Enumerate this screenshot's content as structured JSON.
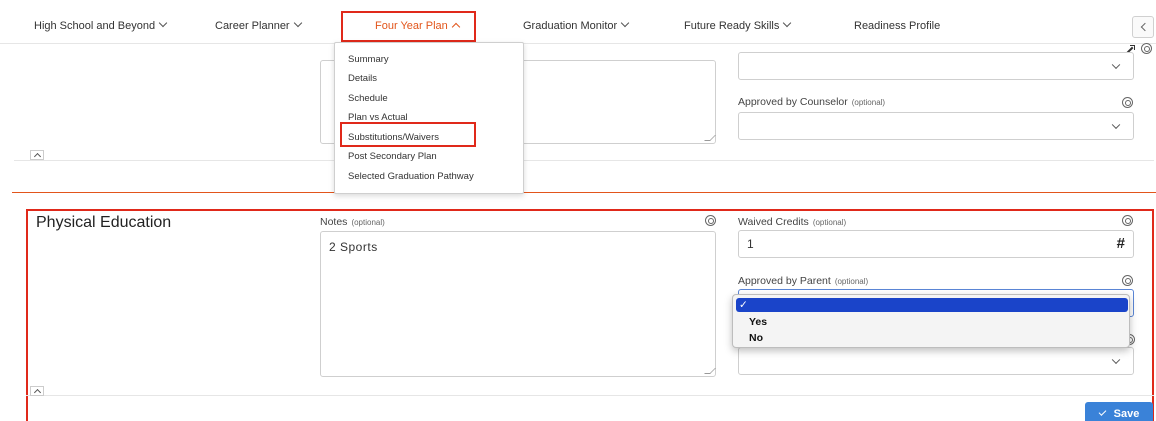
{
  "nav": {
    "items": [
      {
        "label": "High School and Beyond",
        "has_chevron": true,
        "active": false
      },
      {
        "label": "Career Planner",
        "has_chevron": true,
        "active": false
      },
      {
        "label": "Four Year Plan",
        "has_chevron": true,
        "active": true
      },
      {
        "label": "Graduation Monitor",
        "has_chevron": true,
        "active": false
      },
      {
        "label": "Future Ready Skills",
        "has_chevron": true,
        "active": false
      },
      {
        "label": "Readiness Profile",
        "has_chevron": false,
        "active": false
      }
    ],
    "accent_color": "#e2551b"
  },
  "four_year_plan_menu": {
    "items": [
      "Summary",
      "Details",
      "Schedule",
      "Plan vs Actual",
      "Substitutions/Waivers",
      "Post Secondary Plan",
      "Selected Graduation Pathway"
    ],
    "highlighted": "Substitutions/Waivers"
  },
  "upper_section": {
    "approved_by_counselor_label": "Approved by Counselor",
    "optional_tag": "(optional)"
  },
  "section": {
    "title": "Physical Education",
    "notes": {
      "label": "Notes",
      "optional_tag": "(optional)",
      "value": "2 Sports"
    },
    "waived_credits": {
      "label": "Waived Credits",
      "optional_tag": "(optional)",
      "value": "1",
      "suffix_icon": "#"
    },
    "approved_by_parent": {
      "label": "Approved by Parent",
      "optional_tag": "(optional)",
      "options": [
        "",
        "Yes",
        "No"
      ],
      "selected_marker": "✓"
    }
  },
  "save_button": {
    "label": "Save",
    "color": "#3a82d8"
  },
  "highlight_color": "#e0291a"
}
